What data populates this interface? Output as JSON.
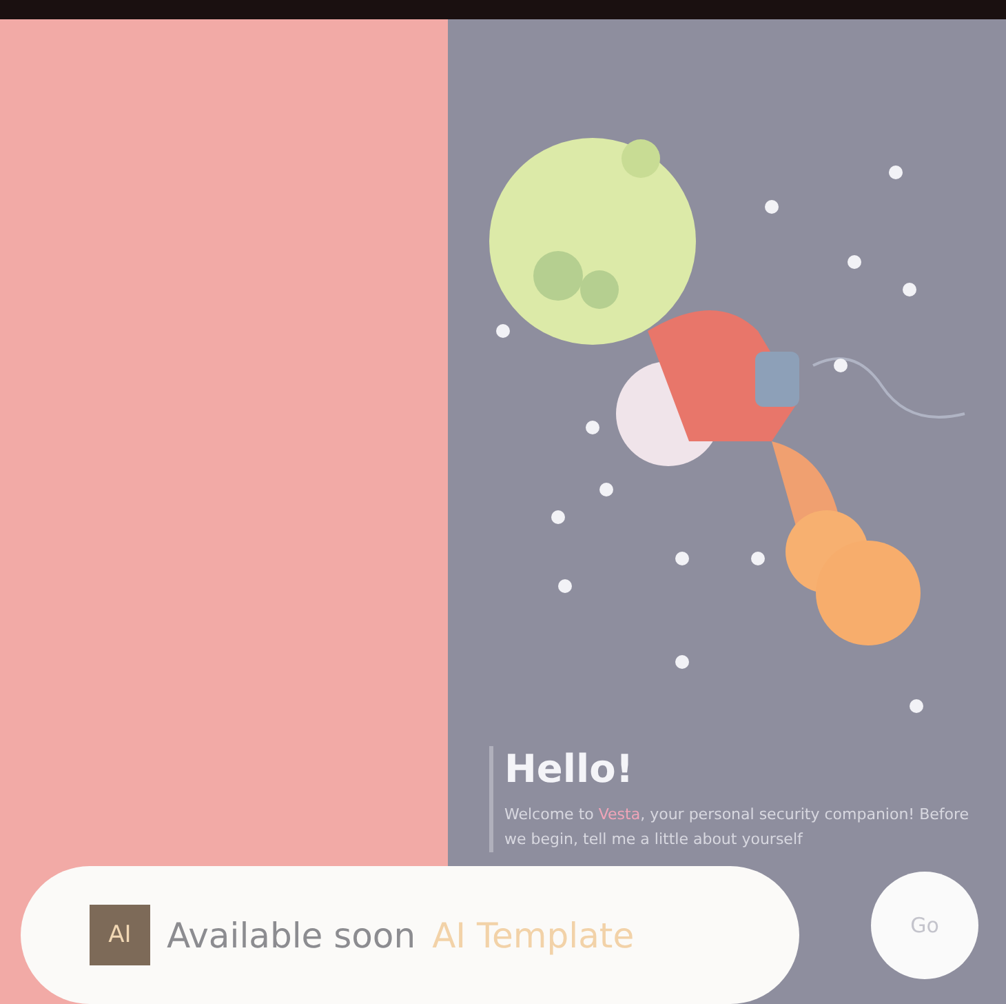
{
  "greeting": {
    "title": "Hello!",
    "message": "Welcome to **Vesta**, your personal security companion! Before we begin, tell me a little about yourself"
  },
  "go_button": {
    "label": "Go"
  },
  "banner": {
    "badge": "AI",
    "text": "Available soon",
    "highlight": "AI Template"
  }
}
